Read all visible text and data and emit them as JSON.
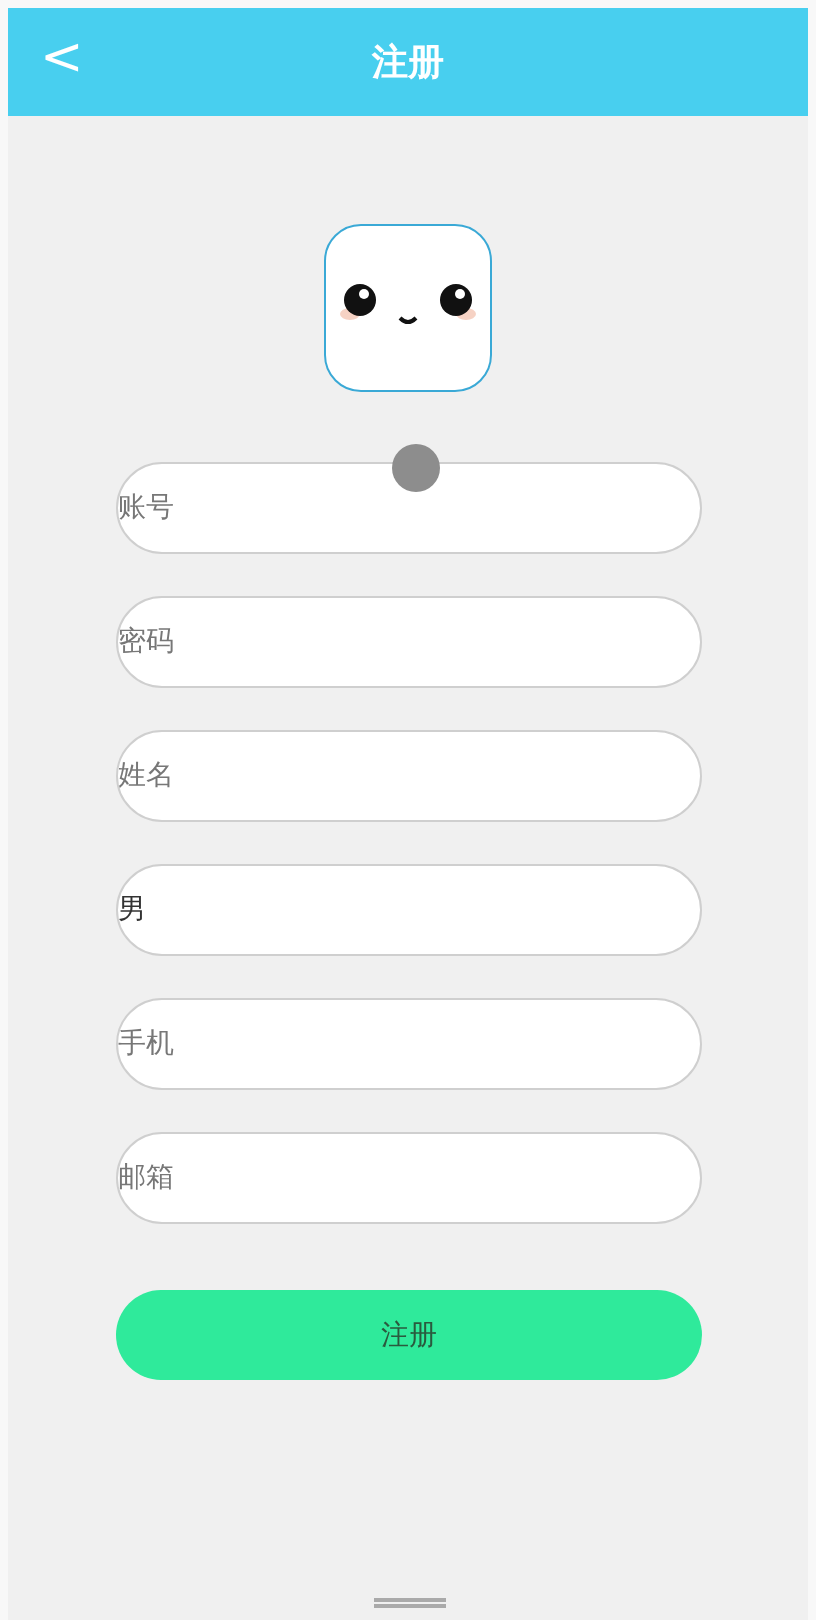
{
  "header": {
    "title": "注册",
    "back": "<"
  },
  "fields": [
    {
      "placeholder": "账号"
    },
    {
      "placeholder": "密码"
    },
    {
      "placeholder": "姓名"
    },
    {
      "value": "男"
    },
    {
      "placeholder": "手机"
    },
    {
      "placeholder": "邮箱"
    }
  ],
  "submit": "注册"
}
